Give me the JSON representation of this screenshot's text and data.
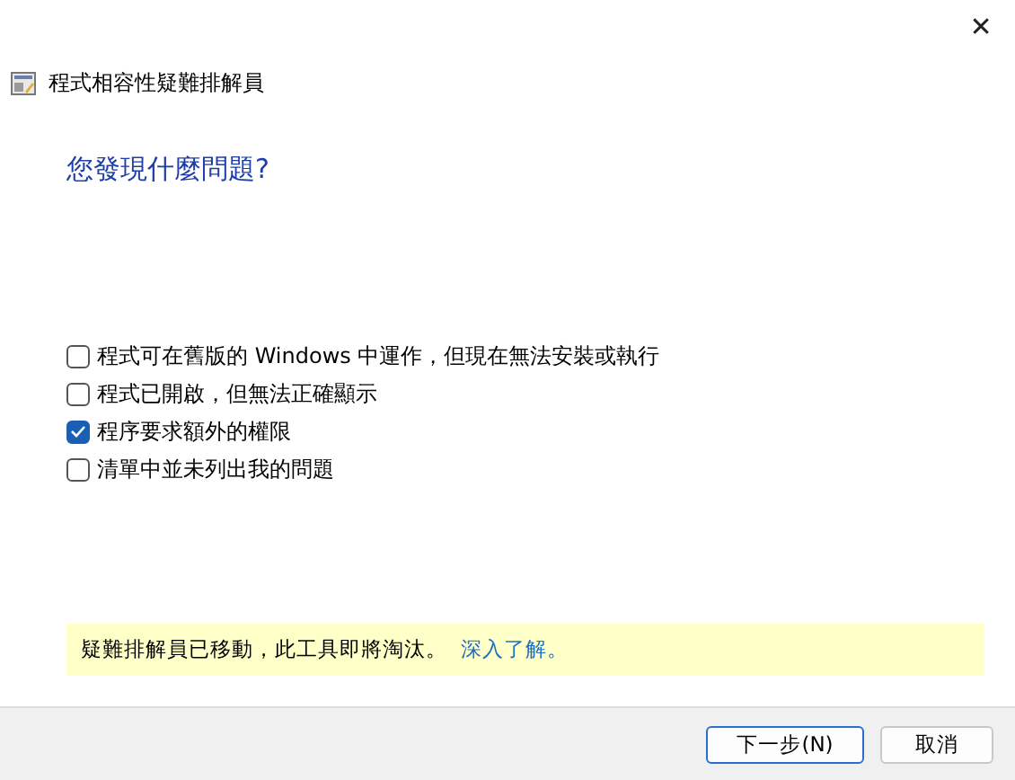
{
  "window": {
    "close_glyph": "✕",
    "title": "程式相容性疑難排解員"
  },
  "heading": "您發現什麼問題?",
  "options": [
    {
      "label": "程式可在舊版的 Windows 中運作，但現在無法安裝或執行",
      "checked": false
    },
    {
      "label": "程式已開啟，但無法正確顯示",
      "checked": false
    },
    {
      "label": "程序要求額外的權限",
      "checked": true
    },
    {
      "label": "清單中並未列出我的問題",
      "checked": false
    }
  ],
  "notice": {
    "text": "疑難排解員已移動，此工具即將淘汰。",
    "link": "深入了解。"
  },
  "buttons": [
    {
      "label": "下一步(N)",
      "kind": "primary"
    },
    {
      "label": "取消",
      "kind": "secondary"
    }
  ]
}
